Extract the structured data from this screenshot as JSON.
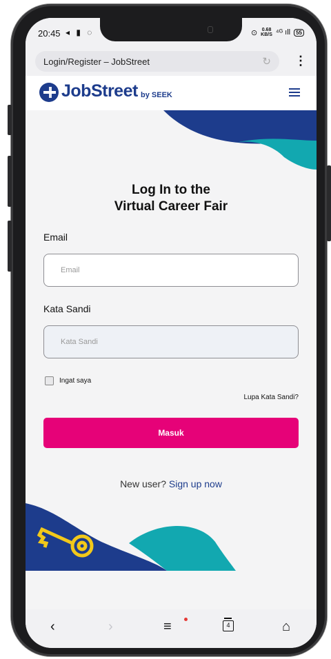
{
  "status_bar": {
    "time": "20:45",
    "left_icons": "◂ ▮ ◌",
    "right_icons": {
      "net_speed_value": "0.68",
      "net_speed_unit": "KB/S",
      "signal": "⁴ᴳ ıll",
      "battery": "55"
    }
  },
  "browser": {
    "url_title": "Login/Register – JobStreet",
    "reload_icon": "reload-icon",
    "menu_icon": "more-vert-icon"
  },
  "header": {
    "logo_text": "JobStreet",
    "logo_by": "by SEEK",
    "menu_icon": "hamburger-icon"
  },
  "colors": {
    "brand_navy": "#1d3c8c",
    "brand_teal": "#12a8b0",
    "brand_pink": "#e60278",
    "key_yellow": "#f2c81a"
  },
  "form": {
    "title_line1": "Log In to the",
    "title_line2": "Virtual Career Fair",
    "email_label": "Email",
    "email_placeholder": "Email",
    "password_label": "Kata Sandi",
    "password_placeholder": "Kata Sandi",
    "remember_label": "Ingat saya",
    "forgot_label": "Lupa Kata Sandi?",
    "submit_label": "Masuk",
    "new_user_text": "New user?",
    "signup_link": "Sign up now"
  },
  "bottom_nav": {
    "back": "‹",
    "forward": "›",
    "menu": "≡",
    "tabs_count": "4",
    "home": "⌂"
  }
}
